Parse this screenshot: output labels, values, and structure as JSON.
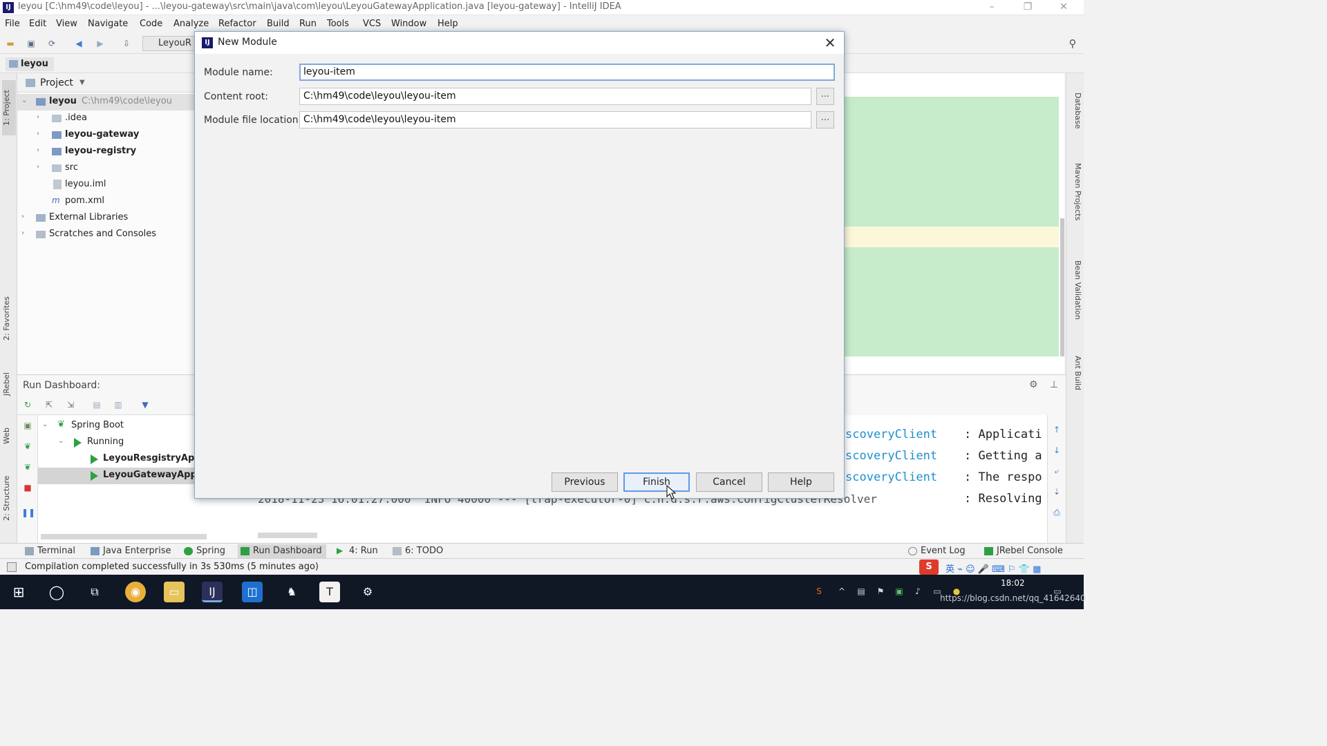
{
  "window": {
    "title": "leyou [C:\\hm49\\code\\leyou] - ...\\leyou-gateway\\src\\main\\java\\com\\leyou\\LeyouGatewayApplication.java [leyou-gateway] - IntelliJ IDEA",
    "minimize": "–",
    "restore": "❐",
    "close": "✕"
  },
  "menu": [
    "File",
    "Edit",
    "View",
    "Navigate",
    "Code",
    "Analyze",
    "Refactor",
    "Build",
    "Run",
    "Tools",
    "VCS",
    "Window",
    "Help"
  ],
  "toolbar": {
    "run_config": "LeyouR",
    "search_icon": "⚲"
  },
  "navbar": {
    "crumb": "leyou"
  },
  "left_stripe": [
    "1: Project",
    "2: Favorites",
    "JRebel",
    "Web",
    "2: Structure"
  ],
  "right_stripe": [
    "Database",
    "Maven Projects",
    "Bean Validation",
    "Ant Build"
  ],
  "project_panel": {
    "header": "Project",
    "tree": [
      {
        "label": "leyou",
        "hint": "C:\\hm49\\code\\leyou",
        "bold": true,
        "arrow": "⌄"
      },
      {
        "label": ".idea",
        "arrow": "›"
      },
      {
        "label": "leyou-gateway",
        "bold": true,
        "arrow": "›"
      },
      {
        "label": "leyou-registry",
        "bold": true,
        "arrow": "›"
      },
      {
        "label": "src",
        "arrow": "›"
      },
      {
        "label": "leyou.iml",
        "arrow": ""
      },
      {
        "label": "pom.xml",
        "arrow": ""
      },
      {
        "label": "External Libraries",
        "arrow": "›"
      },
      {
        "label": "Scratches and Consoles",
        "arrow": "›"
      }
    ]
  },
  "run_dashboard": {
    "header": "Run Dashboard:",
    "tree": [
      {
        "label": "Spring Boot",
        "arrow": "⌄"
      },
      {
        "label": "Running",
        "arrow": "⌄"
      },
      {
        "label": "LeyouResgistryApp"
      },
      {
        "label": "LeyouGatewayApp"
      }
    ],
    "console": [
      {
        "left": "scoveryClient",
        "right": ": Applicati"
      },
      {
        "left": "scoveryClient",
        "right": ": Getting a"
      },
      {
        "left": "scoveryClient",
        "right": ": The respo"
      },
      {
        "left": "2018-11-23 16:01:27.000  INFO 40000 --- [trap-executor-0] c.n.d.s.r.aws.ConfigClusterResolver",
        "right": ": Resolving"
      }
    ]
  },
  "bottom_tabs": [
    {
      "label": "Terminal"
    },
    {
      "label": "Java Enterprise"
    },
    {
      "label": "Spring"
    },
    {
      "label": "Run Dashboard",
      "active": true
    },
    {
      "label": "4: Run"
    },
    {
      "label": "6: TODO"
    }
  ],
  "bottom_right_tabs": [
    {
      "label": "Event Log"
    },
    {
      "label": "JRebel Console"
    }
  ],
  "status": {
    "message": "Compilation completed successfully in 3s 530ms (5 minutes ago)"
  },
  "taskbar": {
    "time": "18:02",
    "watermark": "https://blog.csdn.net/qq_41642640"
  },
  "dialog": {
    "title": "New Module",
    "module_name_label": "Module name:",
    "module_name_value": "leyou-item",
    "content_root_label": "Content root:",
    "content_root_value": "C:\\hm49\\code\\leyou\\leyou-item",
    "module_file_label": "Module file location:",
    "module_file_value": "C:\\hm49\\code\\leyou\\leyou-item",
    "browse": "...",
    "close": "✕",
    "buttons": {
      "previous": "Previous",
      "finish": "Finish",
      "cancel": "Cancel",
      "help": "Help"
    }
  },
  "colors": {
    "accent": "#5c9be6",
    "console_link": "#1d8fd0",
    "run_green": "#2ea043",
    "diff_green": "#c6eccc",
    "taskbar": "#101725"
  }
}
